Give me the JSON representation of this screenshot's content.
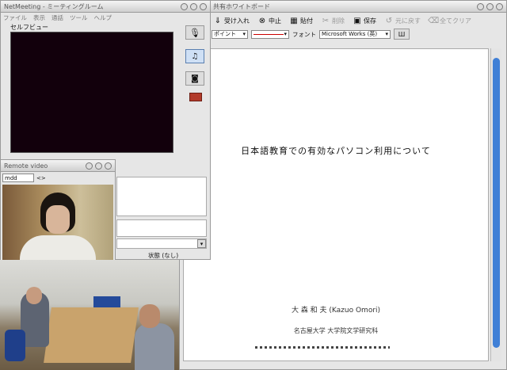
{
  "editor": {
    "title": "共有ホワイトボード",
    "toolbar": [
      {
        "label": "受け入れ",
        "icon": "download-arrow-icon",
        "disabled": false
      },
      {
        "label": "中止",
        "icon": "stop-icon",
        "disabled": false
      },
      {
        "label": "貼付",
        "icon": "paste-icon",
        "disabled": false
      },
      {
        "label": "削除",
        "icon": "scissors-icon",
        "disabled": true
      },
      {
        "label": "保存",
        "icon": "save-icon",
        "disabled": false
      },
      {
        "label": "元に戻す",
        "icon": "undo-icon",
        "disabled": true
      },
      {
        "label": "全てクリア",
        "icon": "clear-all-icon",
        "disabled": true
      }
    ],
    "format": {
      "size": "ポイント",
      "font_label": "フォント",
      "font_name": "Microsoft Works (英)"
    },
    "doc": {
      "title": "日本語教育での有効なパソコン利用について",
      "author": "大 森 和 夫 (Kazuo Omori)",
      "affiliation": "名古屋大学 大学院文学研究科"
    }
  },
  "meeting": {
    "title": "NetMeeting - ミーティングルーム",
    "menu": [
      "ファイル",
      "表示",
      "通話",
      "ツール",
      "ヘルプ"
    ],
    "preview_label": "セルフビュー",
    "status": "状態 (なし)"
  },
  "remote": {
    "title": "Remote video",
    "select": "mdd",
    "nav": "<>"
  },
  "colors": {
    "accent": "#3f7fd6",
    "video_black": "#12000c"
  }
}
